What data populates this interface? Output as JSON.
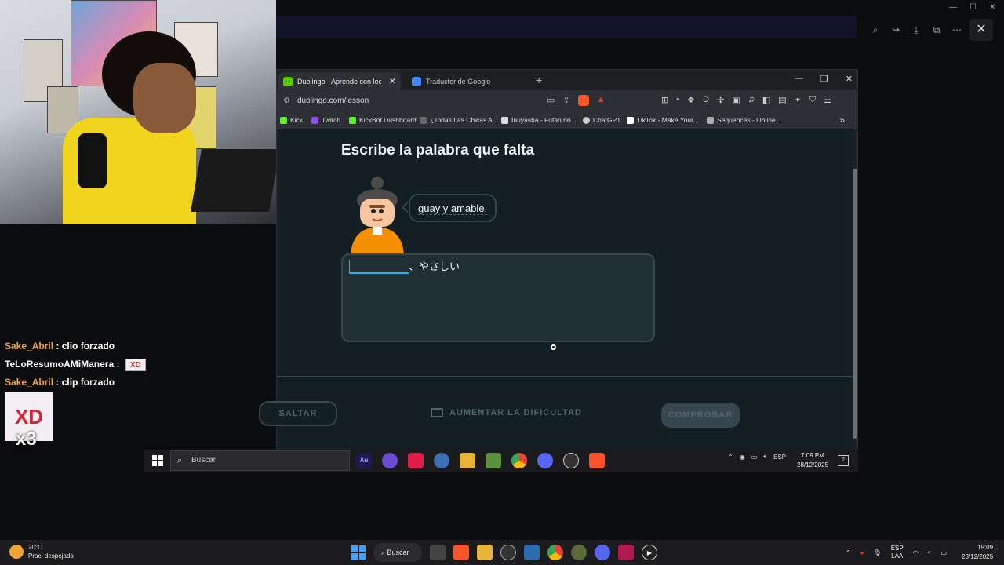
{
  "browser": {
    "tabs": [
      {
        "label": "Duolingo - Aprende con lecciones",
        "active": true
      },
      {
        "label": "Traductor de Google",
        "active": false
      }
    ],
    "url": "duolingo.com/lesson",
    "bookmarks": [
      {
        "label": "Kick",
        "color": "#53fc18"
      },
      {
        "label": "Twitch",
        "color": "#9146ff"
      },
      {
        "label": "KickBot Dashboard",
        "color": "#53fc18"
      },
      {
        "label": "¿Todas Las Chicas A...",
        "color": "#666666"
      },
      {
        "label": "Inuyasha - Futari no...",
        "color": "#dddddd"
      },
      {
        "label": "ChatGPT",
        "color": "#cccccc"
      },
      {
        "label": "TikTok - Make Your...",
        "color": "#ffffff"
      },
      {
        "label": "Sequences - Online...",
        "color": "#aaaaaa"
      }
    ]
  },
  "lesson": {
    "title": "Escribe la palabra que falta",
    "bubble_text": "guay y amable.",
    "prompt_suffix": "、やさしい",
    "skip_label": "SALTAR",
    "increase_label": "AUMENTAR LA DIFICULTAD",
    "check_label": "COMPROBAR"
  },
  "chat": [
    {
      "user": "Sake_Abril",
      "sep": " : ",
      "text": "clio forzado"
    },
    {
      "user": "TeLoResumoAMiManera",
      "sep": " : ",
      "emote": "XD"
    },
    {
      "user": "Sake_Abril",
      "sep": " : ",
      "text": "clip forzado"
    }
  ],
  "chat_big_emote": {
    "text": "XD",
    "multiplier": "x3"
  },
  "inner_taskbar": {
    "search_placeholder": "Buscar",
    "lang": "ESP",
    "time": "7:09 PM",
    "date": "28/12/2025",
    "notif_count": "2",
    "apps": [
      "Au",
      "",
      "",
      "",
      "",
      "",
      "",
      "",
      "",
      "",
      ""
    ]
  },
  "taskbar": {
    "weather_temp": "20°C",
    "weather_desc": "Prac. despejado",
    "search_label": "Buscar",
    "lang_top": "ESP",
    "lang_bottom": "LAA",
    "time": "19:09",
    "date": "28/12/2025"
  },
  "colors": {
    "duo_bg": "#131f23",
    "duo_border": "#37464f",
    "duo_blue": "#1cb0f6",
    "chat_name": "#e9a34a"
  }
}
